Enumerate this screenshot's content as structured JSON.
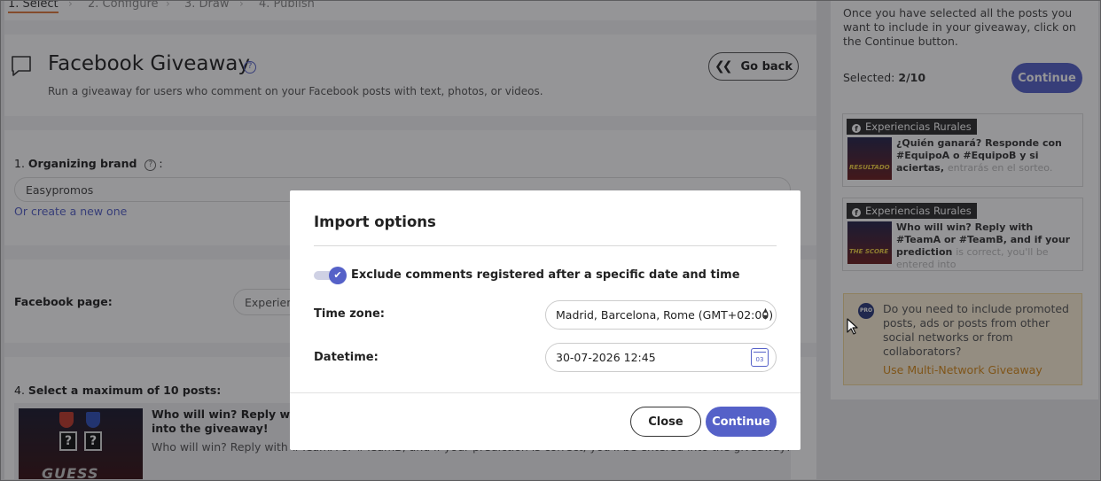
{
  "steps": [
    {
      "label": "1. Select"
    },
    {
      "label": "2. Configure"
    },
    {
      "label": "3. Draw"
    },
    {
      "label": "4. Publish"
    }
  ],
  "header": {
    "title": "Facebook Giveaway",
    "help_glyph": "?",
    "subtitle": "Run a giveaway for users who comment on your Facebook posts with text, photos, or videos.",
    "go_back_label": "Go back"
  },
  "brand": {
    "label_prefix": "1.",
    "label": "Organizing brand",
    "help_glyph": "?",
    "label_suffix": ":",
    "selected": "Easypromos",
    "create_link": "Or create a new one"
  },
  "facebook_page": {
    "label": "Facebook page:",
    "selected": "Experien"
  },
  "posts": {
    "label_prefix": "4.",
    "label": "Select a maximum of 10 posts:",
    "items": [
      {
        "title": "Who will win? Reply with #TeamA or #TeamB, and if your prediction is correct, you'll be entered into the giveaway!",
        "text": "Who will win? Reply with #TeamA or #TeamB, and if your prediction is correct, you'll be entered into the giveaway!",
        "thumb_text": "GUESS"
      }
    ]
  },
  "sidebar": {
    "info": "Once you have selected all the posts you want to include in your giveaway, click on the Continue button.",
    "selected_label": "Selected:",
    "selected_value": "2/10",
    "continue_label": "Continue",
    "selected_posts": [
      {
        "page": "Experiencias Rurales",
        "text": "¿Quién ganará? Responde con #EquipoA o #EquipoB y si aciertas,",
        "faded": "entrarás en el sorteo.",
        "thumb_text": "RESULTADO"
      },
      {
        "page": "Experiencias Rurales",
        "text": "Who will win? Reply with #TeamA or #TeamB, and if your prediction",
        "faded": "is correct, you'll be entered into",
        "thumb_text": "THE SCORE"
      }
    ],
    "promo": {
      "badge": "PRO",
      "text": "Do you need to include promoted posts, ads or posts from other social networks or from collaborators?",
      "link": "Use Multi-Network Giveaway"
    }
  },
  "modal": {
    "title": "Import options",
    "toggle_label": "Exclude comments registered after a specific date and time",
    "toggle_on": true,
    "timezone_label": "Time zone:",
    "timezone_value": "Madrid, Barcelona, Rome (GMT+02:00)",
    "datetime_label": "Datetime:",
    "datetime_value": "30-07-2026 12:45",
    "calendar_day": "03",
    "close_label": "Close",
    "continue_label": "Continue"
  },
  "colors": {
    "accent": "#5561c8",
    "active_step": "#e07a3c",
    "overlay": "rgba(20,20,25,0.45)",
    "promo_bg": "#fdf1d8",
    "promo_link": "#d88a1a"
  }
}
